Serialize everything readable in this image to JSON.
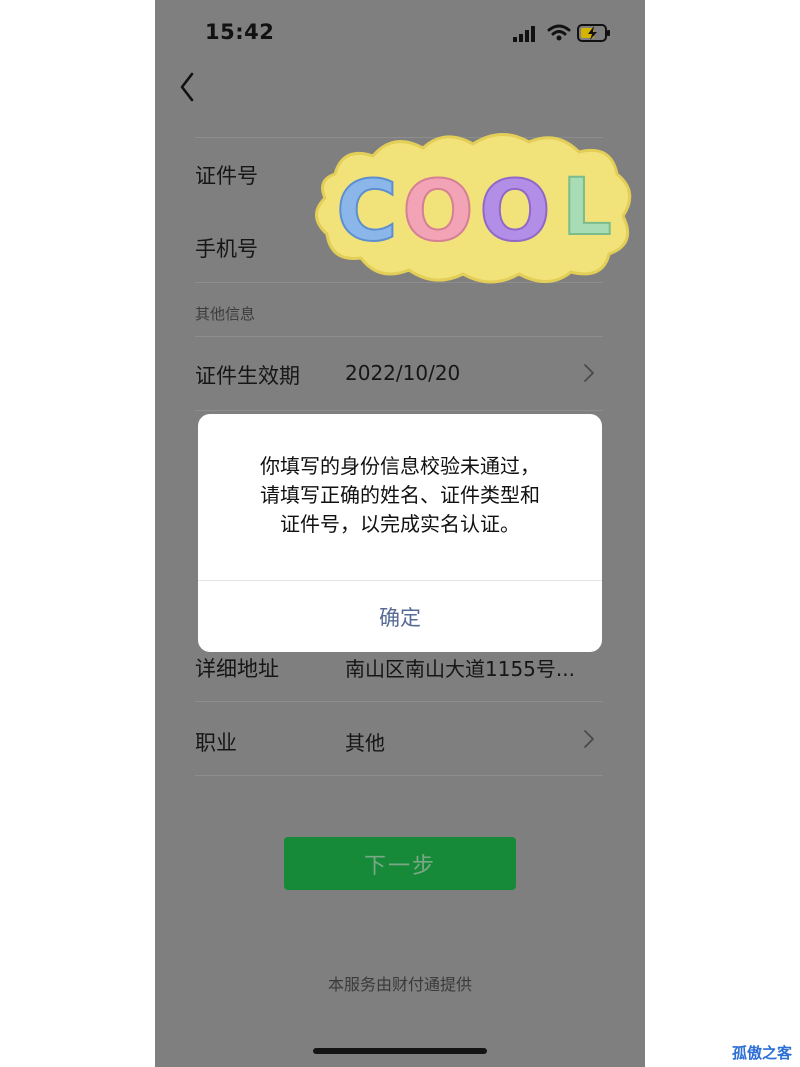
{
  "status_bar": {
    "time": "15:42"
  },
  "form": {
    "rows": [
      {
        "label": "证件号",
        "value": ""
      },
      {
        "label": "手机号",
        "value": ""
      }
    ],
    "section_title": "其他信息",
    "expiry": {
      "label": "证件生效期",
      "value": "2022/10/20"
    },
    "address": {
      "label": "详细地址",
      "value": "南山区南山大道1155号..."
    },
    "occupation": {
      "label": "职业",
      "value": "其他"
    }
  },
  "sticker_text": "COOL",
  "next_button": {
    "label": "下一步"
  },
  "footer": {
    "text": "本服务由财付通提供"
  },
  "dialog": {
    "lines": [
      "你填写的身份信息校验未通过，",
      "请填写正确的姓名、证件类型和",
      "证件号，以完成实名认证。"
    ],
    "confirm_label": "确定"
  },
  "watermark": "孤傲之客",
  "colors": {
    "overlay_bg": "#7f7f7f",
    "primary_button": "#178a3a",
    "dialog_link": "#576b95",
    "watermark": "#2c6fd6"
  },
  "icons": [
    "chevron-left-icon",
    "signal-icon",
    "wifi-icon",
    "battery-charging-icon",
    "chevron-right-icon"
  ]
}
